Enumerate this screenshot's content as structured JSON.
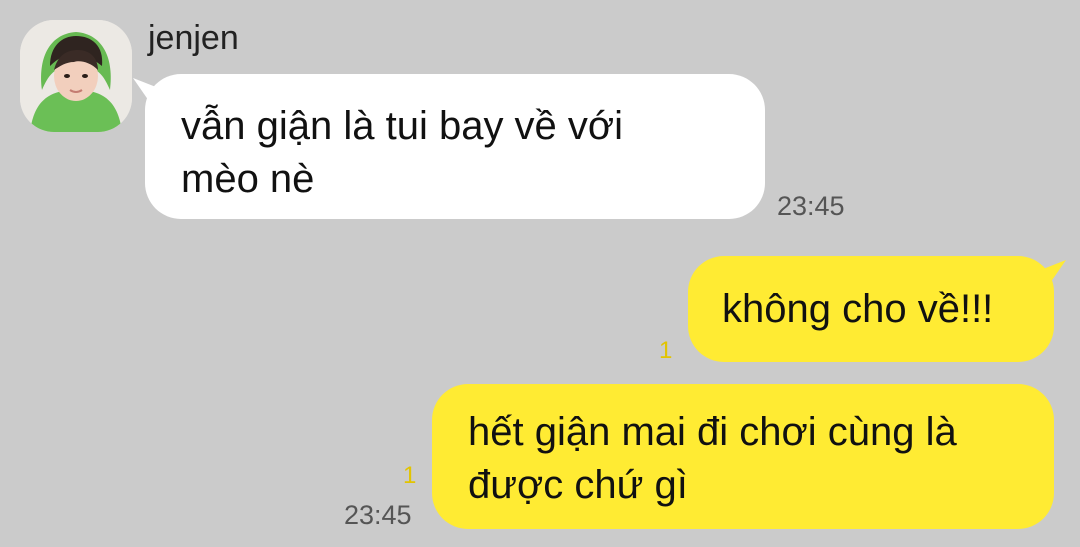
{
  "contact": {
    "name": "jenjen",
    "avatar_icon": "profile-photo"
  },
  "messages": [
    {
      "direction": "incoming",
      "text": "vẫn giận là tui bay về với\nmèo nè",
      "time": "23:45"
    },
    {
      "direction": "outgoing",
      "text": "không cho về!!!",
      "unread": "1"
    },
    {
      "direction": "outgoing",
      "text": "hết giận mai đi chơi cùng là\nđược chứ gì",
      "unread": "1",
      "time": "23:45"
    }
  ],
  "colors": {
    "background": "#cbcbcb",
    "incoming_bubble": "#ffffff",
    "outgoing_bubble": "#ffeb33",
    "unread": "#e2c400"
  }
}
